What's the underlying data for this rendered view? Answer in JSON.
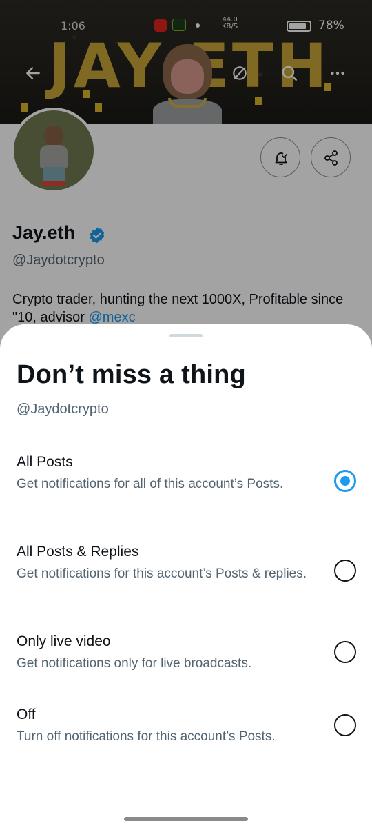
{
  "status_bar": {
    "time": "1:06",
    "speed_value": "44.0",
    "speed_unit": "KB/S",
    "battery": "78%"
  },
  "banner": {
    "text": "JAY ETH",
    "back_icon": "arrow-left-icon",
    "grok_icon": "slash-circle-icon",
    "search_icon": "search-icon",
    "more_icon": "more-horizontal-icon"
  },
  "profile": {
    "name": "Jay.eth",
    "handle": "@Jaydotcrypto",
    "bio_text": "Crypto trader, hunting the next 1000X, Profitable since \"10, advisor ",
    "bio_mention": "@mexc",
    "notification_button_icon": "bell-check-icon",
    "share_button_icon": "share-icon",
    "verified_icon": "verified-badge-icon"
  },
  "sheet": {
    "title": "Don’t miss a thing",
    "handle": "@Jaydotcrypto",
    "options": [
      {
        "label": "All Posts",
        "description": "Get notifications for all of this account’s Posts.",
        "selected": true
      },
      {
        "label": "All Posts & Replies",
        "description": "Get notifications for this account’s Posts & replies.",
        "selected": false
      },
      {
        "label": "Only live video",
        "description": "Get notifications only for live broadcasts.",
        "selected": false
      },
      {
        "label": "Off",
        "description": "Turn off notifications for this account’s Posts.",
        "selected": false
      }
    ]
  },
  "colors": {
    "accent": "#1d9bf0",
    "text_primary": "#0f1419",
    "text_secondary": "#536471",
    "banner_gold": "#c9a536"
  }
}
